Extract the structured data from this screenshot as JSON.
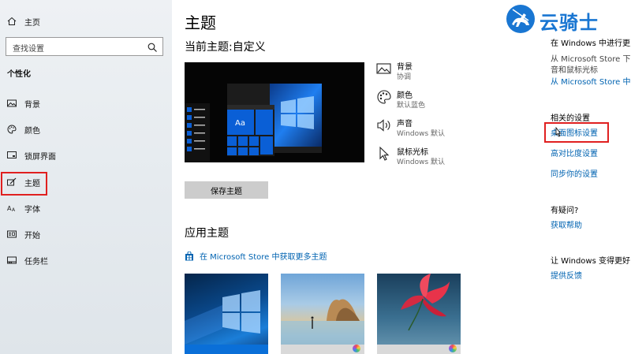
{
  "sidebar": {
    "home_label": "主页",
    "search_placeholder": "查找设置",
    "section_title": "个性化",
    "items": [
      {
        "label": "背景"
      },
      {
        "label": "颜色"
      },
      {
        "label": "锁屏界面"
      },
      {
        "label": "主题"
      },
      {
        "label": "字体"
      },
      {
        "label": "开始"
      },
      {
        "label": "任务栏"
      }
    ]
  },
  "main": {
    "title": "主题",
    "current_theme": "当前主题:自定义",
    "preview_sample_text": "Aa",
    "properties": [
      {
        "name": "背景",
        "value": "协调",
        "icon": "picture-icon"
      },
      {
        "name": "颜色",
        "value": "默认蓝色",
        "icon": "palette-icon"
      },
      {
        "name": "声音",
        "value": "Windows 默认",
        "icon": "speaker-icon"
      },
      {
        "name": "鼠标光标",
        "value": "Windows 默认",
        "icon": "cursor-icon"
      }
    ],
    "save_button": "保存主题",
    "apply_title": "应用主题",
    "store_link": "在 Microsoft Store 中获取更多主题"
  },
  "right_panel": {
    "store_heading": "在 Windows 中进行更多",
    "store_desc_1": "从 Microsoft Store 下载",
    "store_desc_2": "音和鼠标光标",
    "store_link": "从 Microsoft Store 中获取",
    "related_title": "相关的设置",
    "desktop_icon_settings": "桌面图标设置",
    "high_contrast": "高对比度设置",
    "sync": "同步你的设置",
    "question": "有疑问?",
    "get_help": "获取帮助",
    "better_title": "让 Windows 变得更好",
    "feedback": "提供反馈"
  },
  "watermark": {
    "text": "云骑士"
  },
  "colors": {
    "accent": "#0063b1",
    "highlight": "#e02020",
    "tile_blue": "#0a5fd6"
  }
}
